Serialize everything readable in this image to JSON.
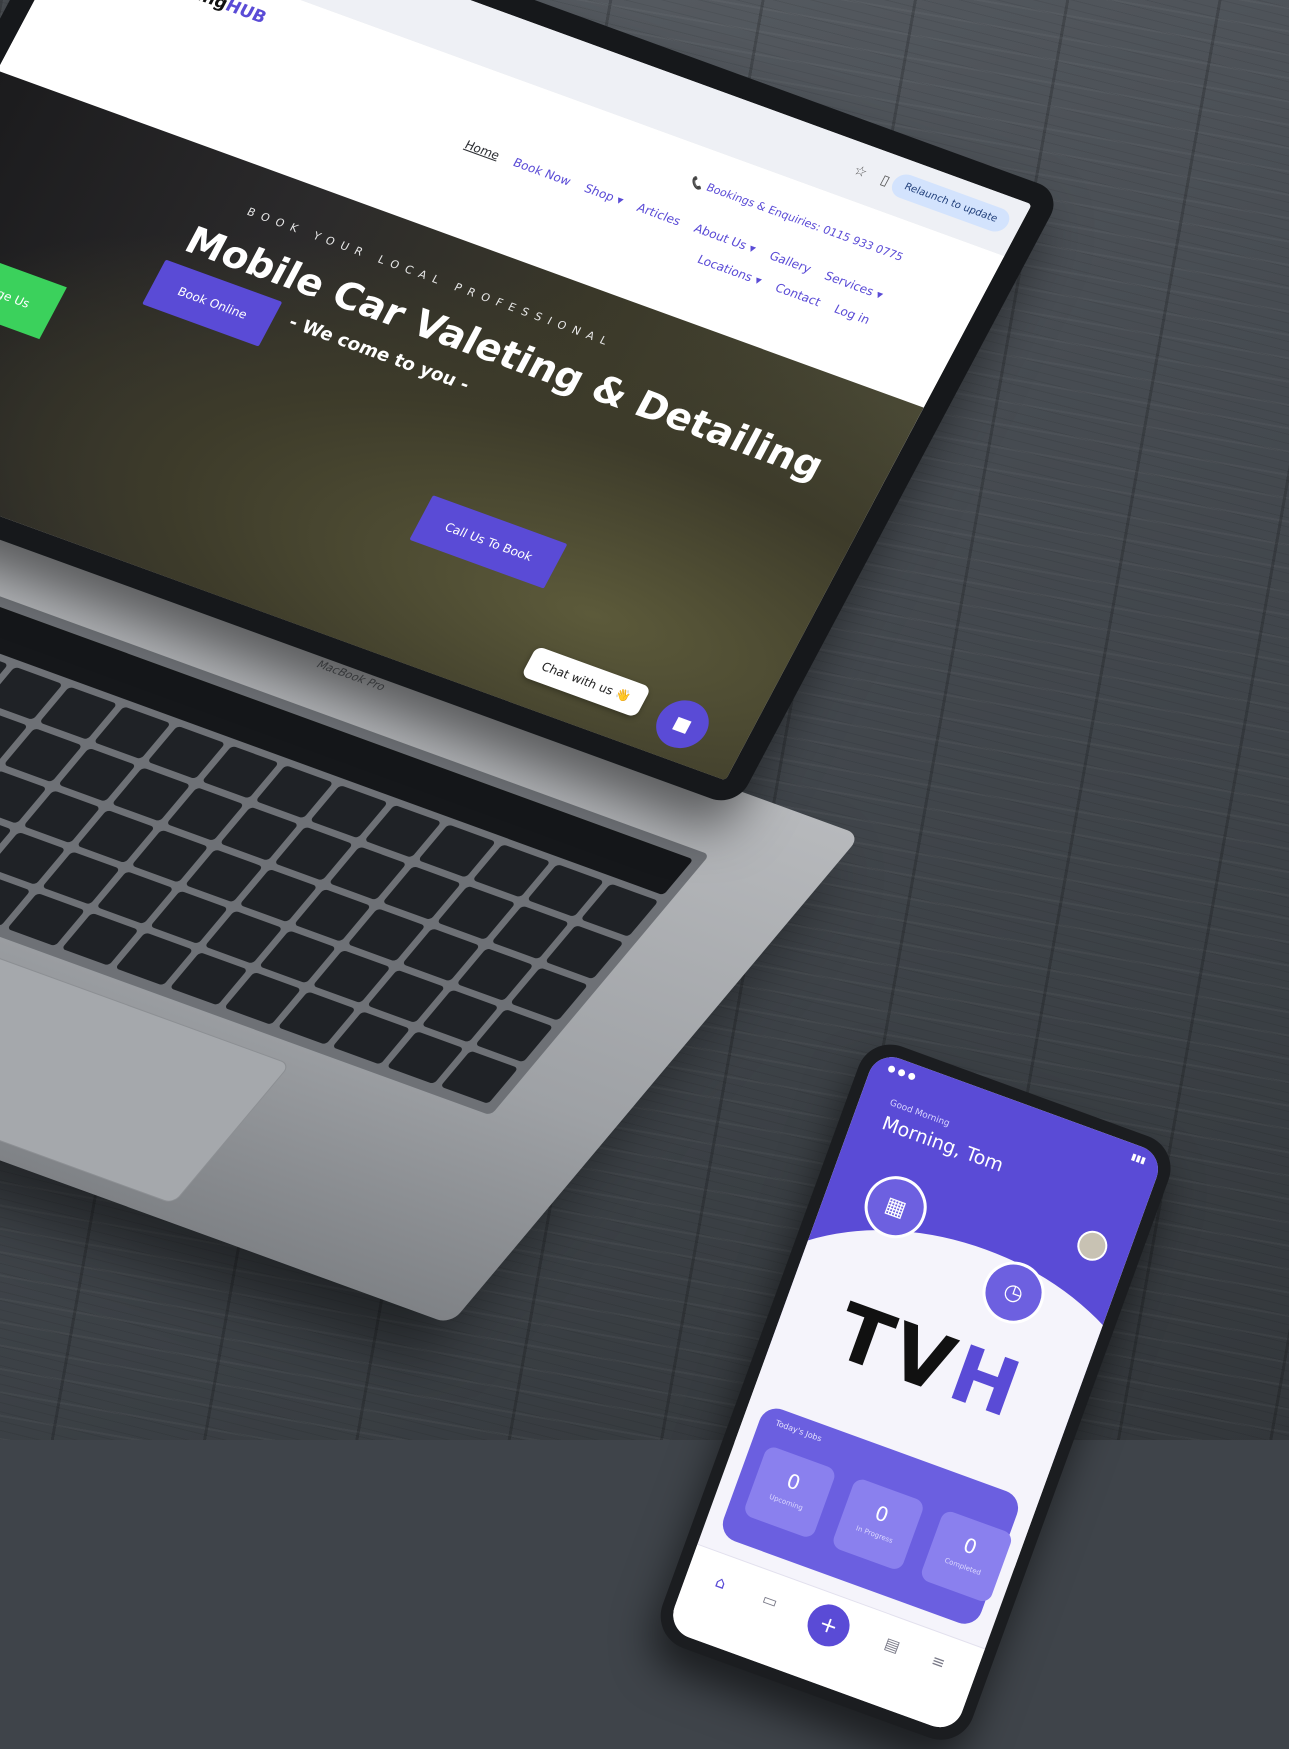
{
  "browser": {
    "relaunch_label": "Relaunch to update"
  },
  "site": {
    "logo_part1": "Thevaleting",
    "logo_part2": "HUB",
    "phone_line": "Bookings & Enquiries: 0115 933 0775",
    "nav_row1": [
      "Home",
      "Book Now",
      "Shop ▾",
      "Articles",
      "About Us ▾",
      "Gallery",
      "Services ▾"
    ],
    "nav_row2": [
      "Locations ▾",
      "Contact",
      "Log in"
    ]
  },
  "hero": {
    "kicker": "BOOK YOUR LOCAL PROFESSIONAL",
    "title": "Mobile Car Valeting & Detailing",
    "subtitle": "- We come to you -",
    "book_online": "Book Online",
    "call_to_book": "Call Us To Book",
    "green_button": "E-Message Us",
    "chat_bubble": "Chat with us 👋"
  },
  "laptop": {
    "brand": "MacBook Pro"
  },
  "phone": {
    "greeting_small": "Good Morning",
    "greeting": "Morning, Tom",
    "logo_part1": "TV",
    "logo_part2": "H",
    "stats_label": "Today's Jobs",
    "stats": [
      {
        "value": "0",
        "label": "Upcoming"
      },
      {
        "value": "0",
        "label": "In Progress"
      },
      {
        "value": "0",
        "label": "Completed"
      }
    ]
  },
  "colors": {
    "brand_purple": "#5a4bd6",
    "green": "#3bd15c"
  }
}
